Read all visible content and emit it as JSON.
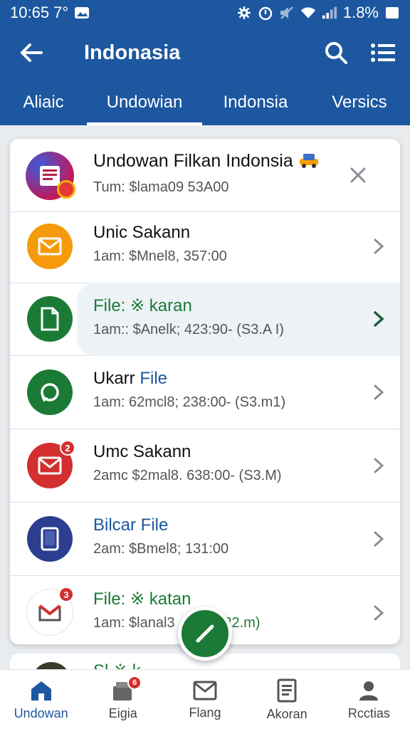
{
  "status_bar": {
    "time": "10:65 7°",
    "battery": "1.8%"
  },
  "app_bar": {
    "title": "Indonasia"
  },
  "tabs": [
    {
      "label": "Aliaic",
      "active": false
    },
    {
      "label": "Undowian",
      "active": true
    },
    {
      "label": "Indonsia",
      "active": false
    },
    {
      "label": "Versics",
      "active": false
    }
  ],
  "list": [
    {
      "title": "Undowan Filkan Indonsia",
      "subtitle": "Tum: $lama09 53A00",
      "trailing": "close"
    },
    {
      "title": "Unic Sakann",
      "subtitle": "1am: $Mnel8, 357:00",
      "trailing": "chevron"
    },
    {
      "title": "File: ※ karan",
      "subtitle": "1am:: $Anelk; 423:90- (S3.A I)",
      "trailing": "chevron"
    },
    {
      "title_a": "Ukarr ",
      "title_b": "File",
      "subtitle": "1am: 62mcl8; 238:00- (S3.m1)",
      "trailing": "chevron"
    },
    {
      "title": "Umc Sakann",
      "subtitle": "2amc $2mal8. 638:00- (S3.M)",
      "badge": "2",
      "trailing": "chevron"
    },
    {
      "title": "Bilcar File",
      "subtitle": "2am: $Bmel8; 131:00",
      "trailing": "chevron"
    },
    {
      "title": "File: ※ katan",
      "subtitle": "1am: $lanal3",
      "subtitle_tail": "- (22.m)",
      "badge": "3",
      "trailing": "chevron"
    }
  ],
  "peek_text": "Sl ※ k",
  "bottom_nav": [
    {
      "label": "Undowan",
      "active": true
    },
    {
      "label": "Eigia",
      "active": false,
      "badge": "6"
    },
    {
      "label": "Flang",
      "active": false
    },
    {
      "label": "Akoran",
      "active": false
    },
    {
      "label": "Rcctias",
      "active": false
    }
  ],
  "colors": {
    "primary": "#1d57a0",
    "green": "#1b7a35",
    "orange": "#f59b0b",
    "red": "#d32f2f",
    "navy": "#2c3e8f",
    "blue_text": "#1d57a0",
    "green_text": "#1b7a35"
  }
}
